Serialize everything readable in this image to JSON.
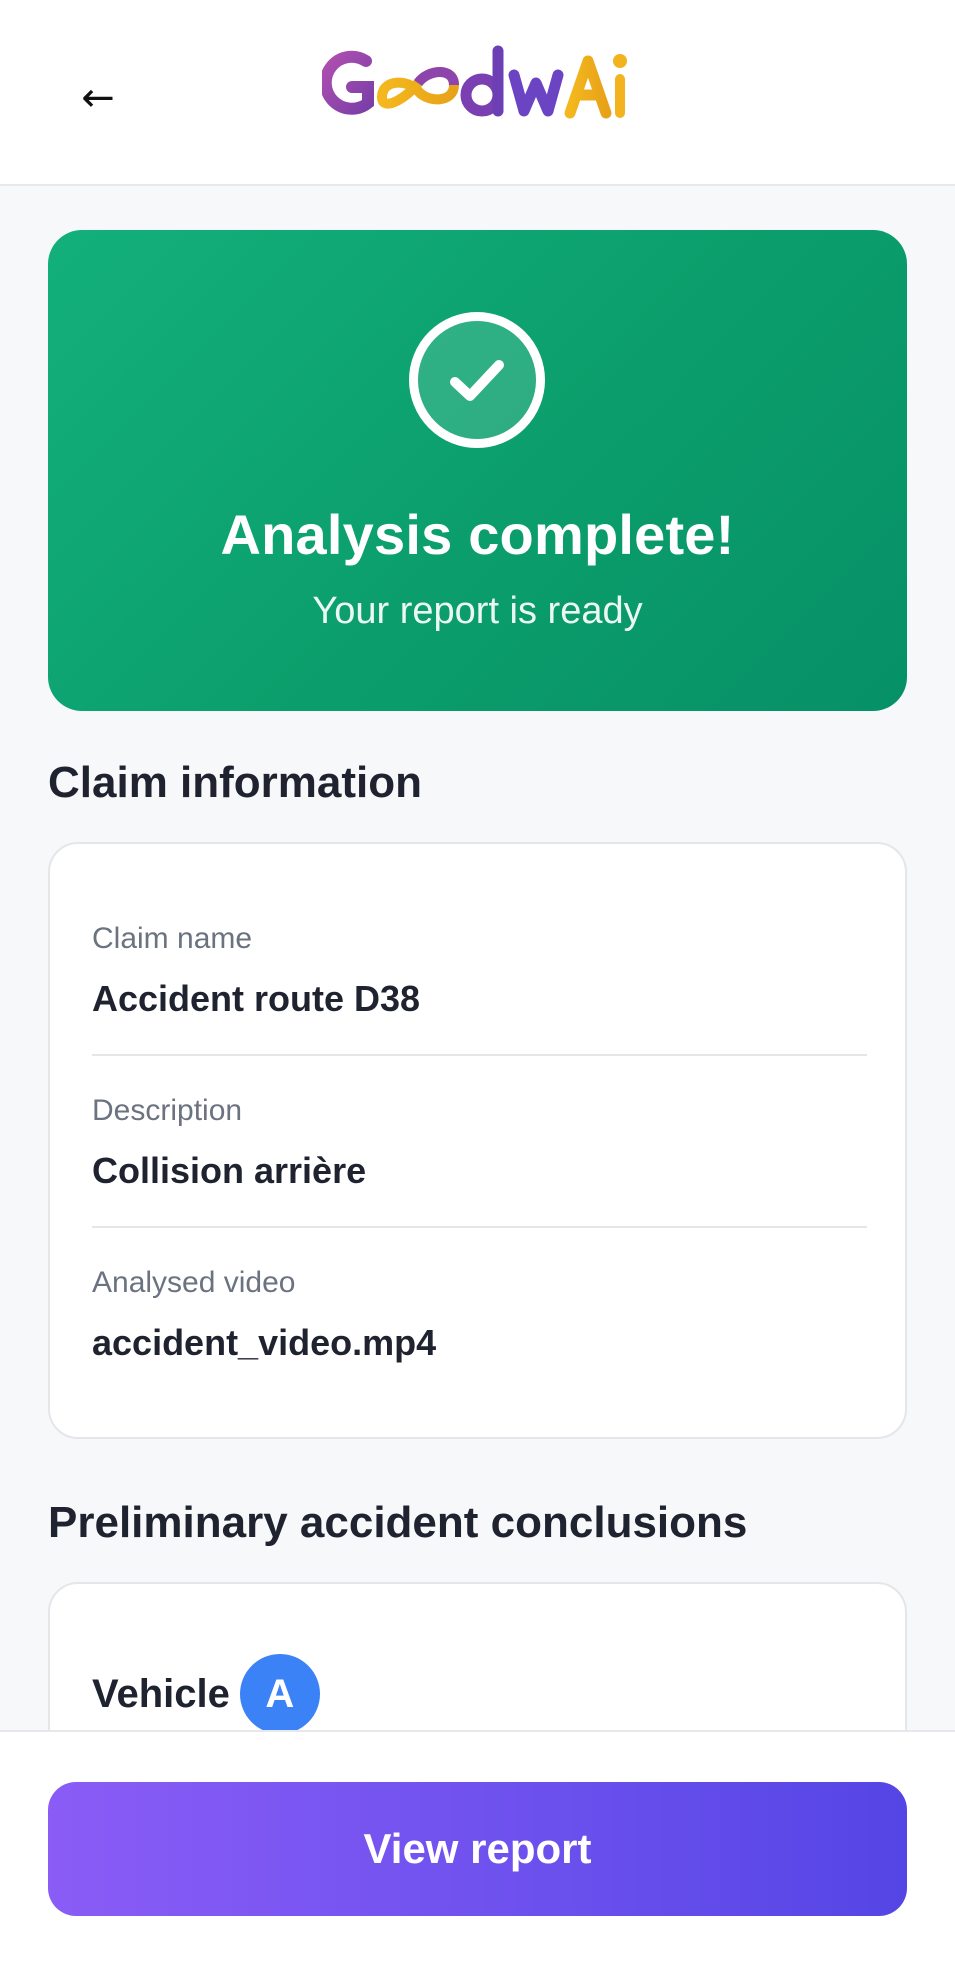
{
  "header": {
    "back_icon": "←",
    "logo_text": "GoodwAI"
  },
  "hero": {
    "icon": "check-circle-icon",
    "title": "Analysis complete!",
    "subtitle": "Your report is ready",
    "color": "#0E9F6E"
  },
  "claim": {
    "section_title": "Claim information",
    "fields": [
      {
        "label": "Claim name",
        "value": "Accident route D38"
      },
      {
        "label": "Description",
        "value": "Collision arrière"
      },
      {
        "label": "Analysed video",
        "value": "accident_video.mp4"
      }
    ]
  },
  "conclusions": {
    "section_title": "Preliminary accident conclusions",
    "vehicle_label": "Vehicle",
    "vehicle_badge": "A",
    "badge_color": "#3B82F6"
  },
  "footer": {
    "cta_label": "View report",
    "cta_color": "#6D51EE"
  }
}
